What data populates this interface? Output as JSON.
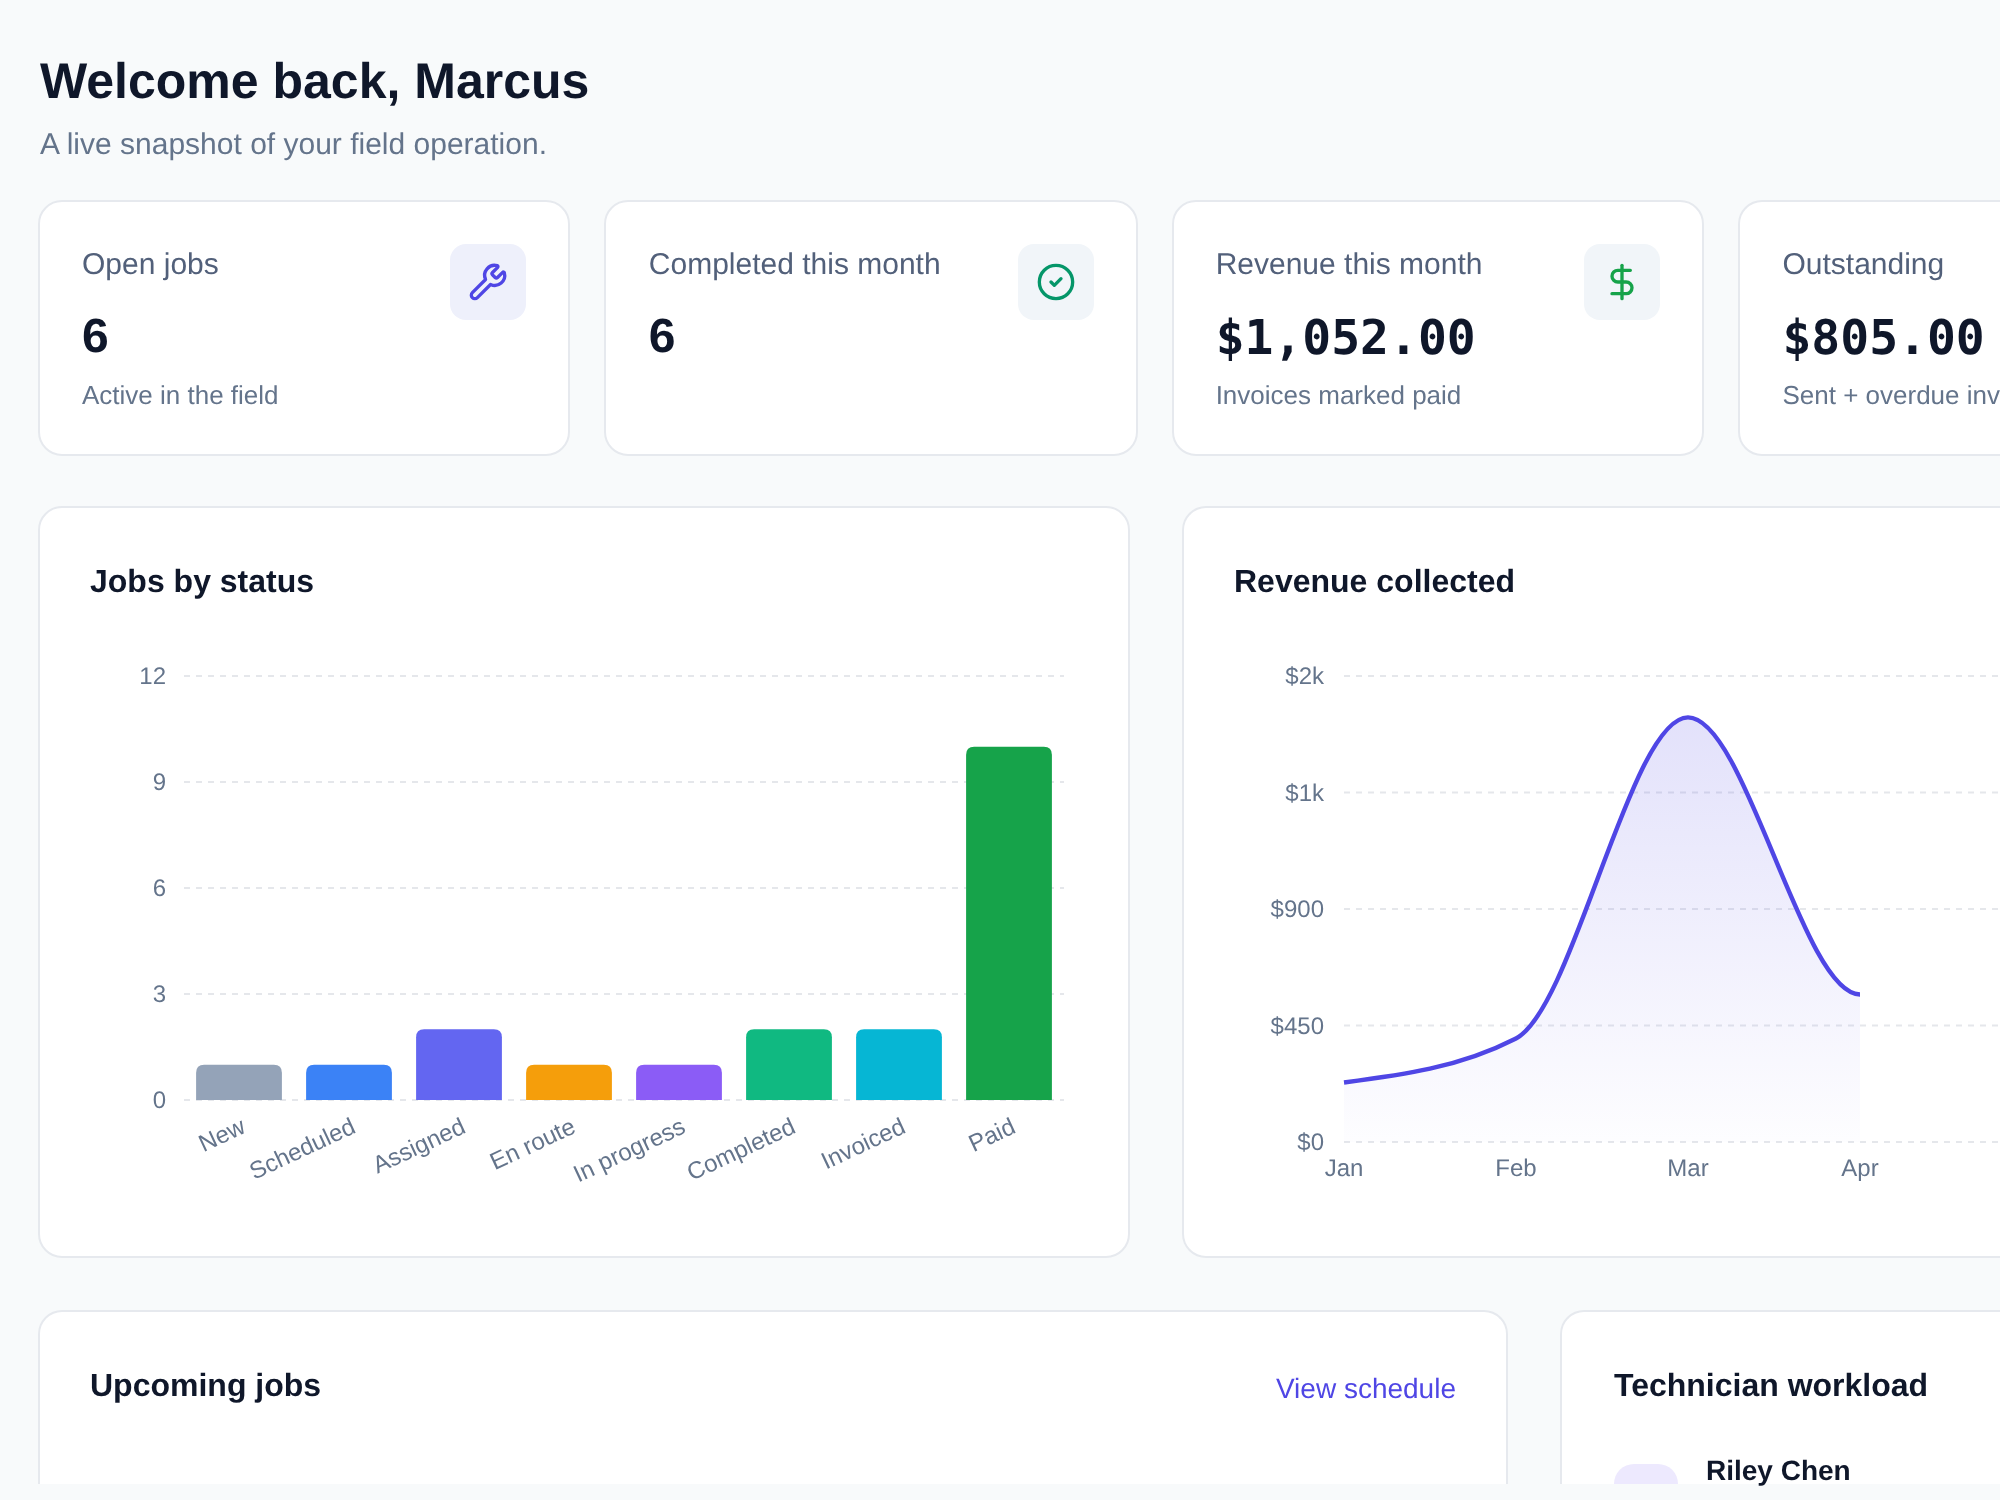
{
  "header": {
    "title": "Welcome back, Marcus",
    "subtitle": "A live snapshot of your field operation."
  },
  "stats": [
    {
      "kind": "count",
      "label": "Open jobs",
      "value": "6",
      "caption": "Active in the field"
    },
    {
      "kind": "count",
      "label": "Completed this month",
      "value": "6"
    },
    {
      "kind": "money",
      "label": "Revenue this month",
      "value": "$1,052.00",
      "caption": "Invoices marked paid"
    },
    {
      "kind": "money",
      "label": "Outstanding",
      "value": "$805.00",
      "caption": "Sent + overdue inv"
    }
  ],
  "jobs_by_status": {
    "title": "Jobs by status",
    "chart_data": {
      "type": "bar",
      "categories": [
        "New",
        "Scheduled",
        "Assigned",
        "En route",
        "In progress",
        "Completed",
        "Invoiced",
        "Paid"
      ],
      "values": [
        1,
        1,
        2,
        1,
        1,
        2,
        2,
        10
      ],
      "colors": [
        "#94a3b8",
        "#3b82f6",
        "#6366f1",
        "#f59e0b",
        "#8b5cf6",
        "#10b981",
        "#06b6d4",
        "#16a34a"
      ],
      "ylim": [
        0,
        12
      ],
      "yticks": [
        0,
        3,
        6,
        9,
        12
      ],
      "grid": true
    }
  },
  "revenue": {
    "title": "Revenue collected",
    "chart_data": {
      "type": "area",
      "categories": [
        "Jan",
        "Feb",
        "Mar",
        "Apr"
      ],
      "values": [
        230,
        400,
        1640,
        570
      ],
      "ylim": [
        0,
        1800
      ],
      "yticks": [
        {
          "value": 0,
          "label": "$0"
        },
        {
          "value": 450,
          "label": "$450"
        },
        {
          "value": 900,
          "label": "$900"
        },
        {
          "value": 1350,
          "label": "$1k"
        },
        {
          "value": 1800,
          "label": "$2k"
        }
      ],
      "grid": true
    }
  },
  "upcoming_jobs": {
    "title": "Upcoming jobs",
    "link": "View schedule"
  },
  "technician_workload": {
    "title": "Technician workload",
    "technicians": [
      {
        "name": "Riley Chen"
      }
    ]
  }
}
